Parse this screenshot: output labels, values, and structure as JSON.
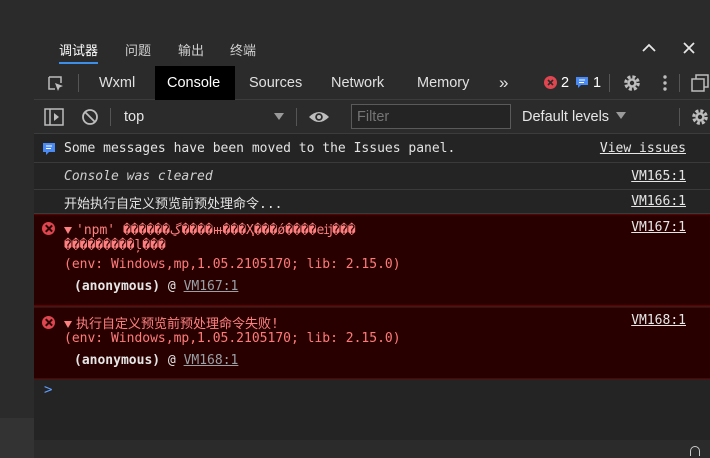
{
  "tool_tabs": [
    "调试器",
    "问题",
    "输出",
    "终端"
  ],
  "active_tool_tab": "调试器",
  "devtools_tabs": [
    "Wxml",
    "Console",
    "Sources",
    "Network",
    "Memory"
  ],
  "active_devtools_tab": "Console",
  "more_tabs_label": "»",
  "counts": {
    "errors": "2",
    "messages": "1"
  },
  "toolbar": {
    "context": "top",
    "filter_placeholder": "Filter",
    "levels": "Default levels"
  },
  "messages": [
    {
      "type": "info",
      "text": "Some messages have been moved to the Issues panel.",
      "link": "View issues"
    },
    {
      "type": "cleared",
      "text": "Console was cleared",
      "source": "VM165:1"
    },
    {
      "type": "log",
      "text": "开始执行自定义预览前预处理命令...",
      "source": "VM166:1"
    },
    {
      "type": "error",
      "text": "'npm' ������ڲ����ⲿ���Ҳ���ǿ����еĳ���",
      "text2": "���������ļ���",
      "env": "(env: Windows,mp,1.05.2105170; lib: 2.15.0)",
      "stack_fn": "(anonymous)",
      "stack_at": "@",
      "stack_link": "VM167:1",
      "source": "VM167:1"
    },
    {
      "type": "error",
      "text": "执行自定义预览前预处理命令失败!",
      "env": "(env: Windows,mp,1.05.2105170; lib: 2.15.0)",
      "stack_fn": "(anonymous)",
      "stack_at": "@",
      "stack_link": "VM168:1",
      "source": "VM168:1"
    }
  ],
  "prompt": ">",
  "colors": {
    "accent": "#3d8ee8",
    "error_bg": "#290000",
    "error_text": "#ff8080",
    "active_tab_bg": "#000000"
  }
}
